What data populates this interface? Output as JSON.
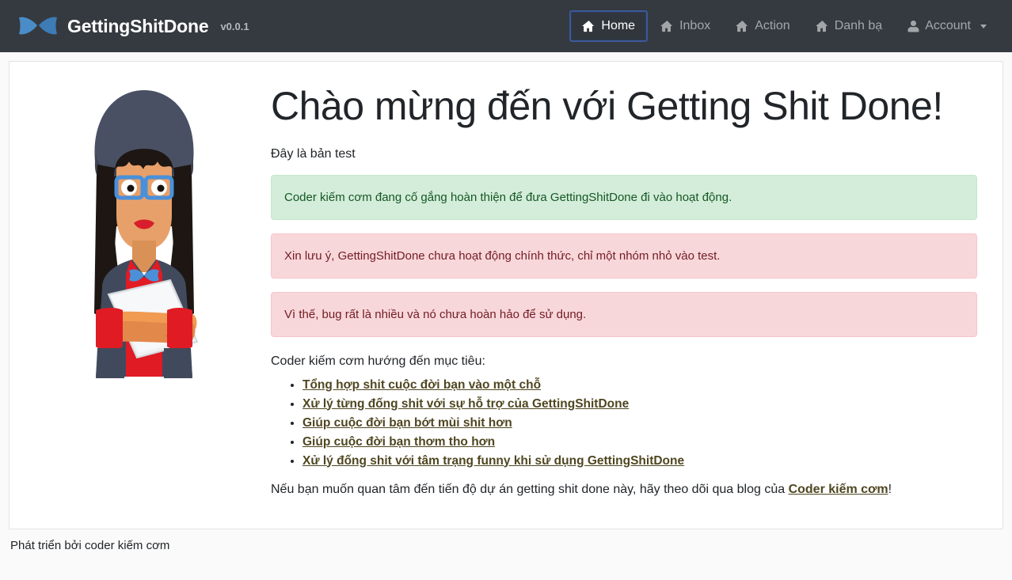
{
  "navbar": {
    "brand": {
      "name": "GettingShitDone",
      "version": "v0.0.1",
      "logo_icon": "bowtie-icon",
      "logo_color": "#4a8cc7"
    },
    "background_color": "#343a40",
    "items": [
      {
        "label": "Home",
        "icon": "home-icon",
        "active": true,
        "focus_outline_color": "#3c5a96"
      },
      {
        "label": "Inbox",
        "icon": "home-icon",
        "active": false
      },
      {
        "label": "Action",
        "icon": "home-icon",
        "active": false
      },
      {
        "label": "Danh bạ",
        "icon": "home-icon",
        "active": false
      },
      {
        "label": "Account",
        "icon": "person-icon",
        "active": false,
        "has_caret": true
      }
    ]
  },
  "main": {
    "illustration_name": "woman-with-laptop-illustration",
    "heading": "Chào mừng đến với Getting Shit Done!",
    "subtitle": "Đây là bản test",
    "alerts": [
      {
        "type": "success",
        "color": "#d4edda",
        "text": "Coder kiếm cơm đang cố gắng hoàn thiện để đưa GettingShitDone đi vào hoạt động."
      },
      {
        "type": "danger",
        "color": "#f8d7da",
        "text": "Xin lưu ý, GettingShitDone chưa hoạt động chính thức, chỉ một nhóm nhỏ vào test."
      },
      {
        "type": "danger",
        "color": "#f8d7da",
        "text": "Vì thế, bug rất là nhiều và nó chưa hoàn hảo để sử dụng."
      }
    ],
    "goals_intro": "Coder kiếm cơm hướng đến mục tiêu:",
    "goals": [
      "Tổng hợp shit cuộc đời bạn vào một chỗ",
      "Xử lý từng đống shit với sự hỗ trợ của GettingShitDone",
      "Giúp cuộc đời bạn bớt mùi shit hơn",
      "Giúp cuộc đời bạn thơm tho hơn",
      "Xử lý đống shit với tâm trạng funny khi sử dụng GettingShitDone"
    ],
    "closing": {
      "before": "Nếu bạn muốn quan tâm đến tiến độ dự án getting shit done này, hãy theo dõi qua blog của ",
      "link": "Coder kiếm cơm",
      "after": "!"
    }
  },
  "footer": {
    "text": "Phát triển bởi coder kiếm cơm"
  }
}
